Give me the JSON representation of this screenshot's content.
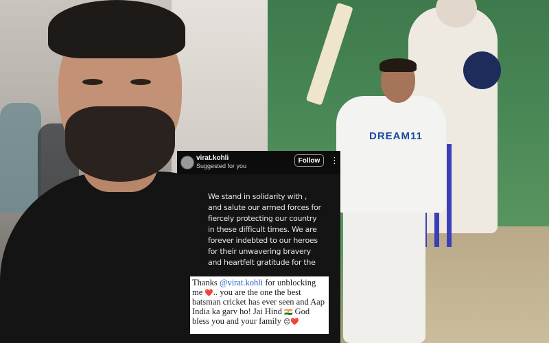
{
  "instagram_post": {
    "username": "virat.kohli",
    "subtitle": "Suggested for you",
    "follow_label": "Follow",
    "more_icon": "more-options-icon",
    "post_text": "We stand in solidarity with , and salute our armed forces for fiercely protecting our country in these difficult times. We are forever indebted to our heroes for their unwavering bravery and heartfelt gratitude for the"
  },
  "comment": {
    "part1": "Thanks ",
    "mention": "@virat.kohli",
    "part2": " for unblocking me ",
    "heart_emoji": "❤️",
    "part3": ".. you are the one the best batsman cricket has ever seen and Aap India ka garv ho! Jai Hind ",
    "flag_emoji": "🇮🇳",
    "part4": " God bless you and your family ",
    "end_emojis": "😊❤️"
  },
  "right_photo": {
    "shirt_sponsor": "DREAM11"
  },
  "colors": {
    "card_bg": "#0c0c0c",
    "mention_blue": "#1e56c8",
    "stump_blue": "#3a3fb8"
  }
}
